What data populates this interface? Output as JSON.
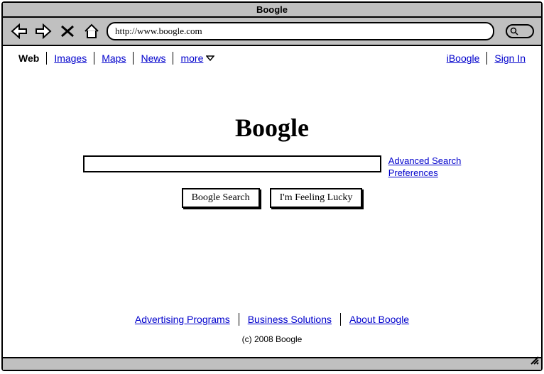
{
  "window": {
    "title": "Boogle"
  },
  "browser": {
    "url": "http://www.boogle.com"
  },
  "nav": {
    "tabs": [
      {
        "label": "Web",
        "active": true
      },
      {
        "label": "Images"
      },
      {
        "label": "Maps"
      },
      {
        "label": "News"
      },
      {
        "label": "more"
      }
    ],
    "right": [
      {
        "label": "iBoogle"
      },
      {
        "label": "Sign In"
      }
    ]
  },
  "main": {
    "logo": "Boogle",
    "search_value": "",
    "side_links": {
      "advanced": "Advanced Search",
      "preferences": "Preferences"
    },
    "buttons": {
      "search": "Boogle Search",
      "lucky": "I'm Feeling Lucky"
    }
  },
  "footer": {
    "links": {
      "ads": "Advertising Programs",
      "biz": "Business Solutions",
      "about": "About Boogle"
    },
    "copyright": "(c) 2008 Boogle"
  }
}
